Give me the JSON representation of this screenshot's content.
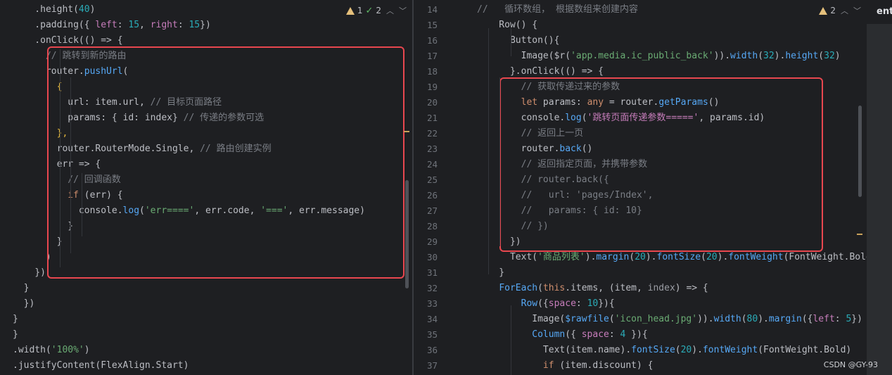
{
  "left_editor": {
    "inspection": {
      "warnings": "1",
      "weak_warnings": "2"
    },
    "lines": [
      [
        [
          "    .height(",
          "plain"
        ],
        [
          "40",
          "num"
        ],
        [
          ")",
          "plain"
        ]
      ],
      [
        [
          "    .padding({ ",
          "plain"
        ],
        [
          "left",
          "key"
        ],
        [
          ": ",
          "plain"
        ],
        [
          "15",
          "num"
        ],
        [
          ", ",
          "plain"
        ],
        [
          "right",
          "key"
        ],
        [
          ": ",
          "plain"
        ],
        [
          "15",
          "num"
        ],
        [
          "})",
          "plain"
        ]
      ],
      [
        [
          "    .onClick(() => {",
          "plain"
        ]
      ],
      [
        [
          "      // 跳转到新的路由",
          "comment"
        ]
      ],
      [
        [
          "      router.",
          "plain"
        ],
        [
          "pushUrl",
          "fn"
        ],
        [
          "(",
          "plain"
        ]
      ],
      [
        [
          "        {",
          "brace"
        ]
      ],
      [
        [
          "          url: item.url, ",
          "plain"
        ],
        [
          "// 目标页面路径",
          "comment"
        ]
      ],
      [
        [
          "          params: { id: index} ",
          "plain"
        ],
        [
          "// 传递的参数可选",
          "comment"
        ]
      ],
      [
        [
          "        },",
          "brace"
        ]
      ],
      [
        [
          "        router.RouterMode.Single, ",
          "plain"
        ],
        [
          "// 路由创建实例",
          "comment"
        ]
      ],
      [
        [
          "        err => {",
          "plain"
        ]
      ],
      [
        [
          "          // 回调函数",
          "comment"
        ]
      ],
      [
        [
          "          ",
          "plain"
        ],
        [
          "if",
          "kw"
        ],
        [
          " (err) {",
          "plain"
        ]
      ],
      [
        [
          "            console.",
          "plain"
        ],
        [
          "log",
          "fn"
        ],
        [
          "(",
          "plain"
        ],
        [
          "'err===='",
          "str"
        ],
        [
          ", err.code, ",
          "plain"
        ],
        [
          "'==='",
          "str"
        ],
        [
          ", err.message)",
          "plain"
        ]
      ],
      [
        [
          "          }",
          "plain"
        ]
      ],
      [
        [
          "        }",
          "plain"
        ]
      ],
      [
        [
          "      )",
          "plain"
        ]
      ],
      [
        [
          "    })",
          "plain"
        ]
      ],
      [
        [
          "  }",
          "plain"
        ]
      ],
      [
        [
          "  })",
          "plain"
        ]
      ],
      [
        [
          "}",
          "plain"
        ]
      ],
      [
        [
          "}",
          "plain"
        ]
      ],
      [
        [
          ".width(",
          "plain"
        ],
        [
          "'100%'",
          "str"
        ],
        [
          ")",
          "plain"
        ]
      ],
      [
        [
          ".justifyContent(FlexAlign.Start)",
          "plain"
        ]
      ]
    ]
  },
  "right_editor": {
    "inspection": {
      "warnings": "2"
    },
    "line_numbers": [
      "14",
      "15",
      "16",
      "17",
      "18",
      "19",
      "20",
      "21",
      "22",
      "23",
      "24",
      "25",
      "26",
      "27",
      "28",
      "29",
      "30",
      "31",
      "32",
      "33",
      "34",
      "35",
      "36",
      "37"
    ],
    "lines": [
      [
        [
          "//   循环数组， 根据数组来创建内容",
          "comment"
        ]
      ],
      [
        [
          "    Row() {",
          "plain"
        ]
      ],
      [
        [
          "      Button(){",
          "plain"
        ]
      ],
      [
        [
          "        Image($r(",
          "plain"
        ],
        [
          "'app.media.ic_public_back'",
          "str"
        ],
        [
          ")).",
          "plain"
        ],
        [
          "width",
          "fn"
        ],
        [
          "(",
          "plain"
        ],
        [
          "32",
          "num"
        ],
        [
          ").",
          "plain"
        ],
        [
          "height",
          "fn"
        ],
        [
          "(",
          "plain"
        ],
        [
          "32",
          "num"
        ],
        [
          ")",
          "plain"
        ]
      ],
      [
        [
          "      }.onClick(() => {",
          "plain"
        ]
      ],
      [
        [
          "        // 获取传递过来的参数",
          "comment"
        ]
      ],
      [
        [
          "        ",
          "plain"
        ],
        [
          "let",
          "kw"
        ],
        [
          " params: ",
          "plain"
        ],
        [
          "any",
          "kw"
        ],
        [
          " = router.",
          "plain"
        ],
        [
          "getParams",
          "fn"
        ],
        [
          "()",
          "plain"
        ]
      ],
      [
        [
          "        console.",
          "plain"
        ],
        [
          "log",
          "fn"
        ],
        [
          "(",
          "plain"
        ],
        [
          "'跳转页面传递参数====='",
          "str2"
        ],
        [
          ", params.id)",
          "plain"
        ]
      ],
      [
        [
          "        // 返回上一页",
          "comment"
        ]
      ],
      [
        [
          "        router.",
          "plain"
        ],
        [
          "back",
          "fn"
        ],
        [
          "()",
          "plain"
        ]
      ],
      [
        [
          "        // 返回指定页面，并携带参数",
          "comment"
        ]
      ],
      [
        [
          "        // router.back({",
          "comment"
        ]
      ],
      [
        [
          "        //   url: 'pages/Index',",
          "comment"
        ]
      ],
      [
        [
          "        //   params: { id: 10}",
          "comment"
        ]
      ],
      [
        [
          "        // })",
          "comment"
        ]
      ],
      [
        [
          "      })",
          "plain"
        ]
      ],
      [
        [
          "      Text(",
          "plain"
        ],
        [
          "'商品列表'",
          "str"
        ],
        [
          ").",
          "plain"
        ],
        [
          "margin",
          "fn"
        ],
        [
          "(",
          "plain"
        ],
        [
          "20",
          "num"
        ],
        [
          ").",
          "plain"
        ],
        [
          "fontSize",
          "fn"
        ],
        [
          "(",
          "plain"
        ],
        [
          "20",
          "num"
        ],
        [
          ").",
          "plain"
        ],
        [
          "fontWeight",
          "fn"
        ],
        [
          "(FontWeight.Bold",
          "plain"
        ]
      ],
      [
        [
          "    }",
          "plain"
        ]
      ],
      [
        [
          "    ",
          "plain"
        ],
        [
          "ForEach",
          "fn"
        ],
        [
          "(",
          "plain"
        ],
        [
          "this",
          "kw"
        ],
        [
          ".items, (item, ",
          "plain"
        ],
        [
          "index",
          "param"
        ],
        [
          ") => {",
          "plain"
        ]
      ],
      [
        [
          "        ",
          "plain"
        ],
        [
          "Row",
          "fn"
        ],
        [
          "({",
          "plain"
        ],
        [
          "space",
          "key"
        ],
        [
          ": ",
          "plain"
        ],
        [
          "10",
          "num"
        ],
        [
          "}){",
          "plain"
        ]
      ],
      [
        [
          "          Image(",
          "plain"
        ],
        [
          "$rawfile",
          "fn"
        ],
        [
          "(",
          "plain"
        ],
        [
          "'icon_head.jpg'",
          "str"
        ],
        [
          ")).",
          "plain"
        ],
        [
          "width",
          "fn"
        ],
        [
          "(",
          "plain"
        ],
        [
          "80",
          "num"
        ],
        [
          ").",
          "plain"
        ],
        [
          "margin",
          "fn"
        ],
        [
          "({",
          "plain"
        ],
        [
          "left",
          "key"
        ],
        [
          ": ",
          "plain"
        ],
        [
          "5",
          "num"
        ],
        [
          "})",
          "plain"
        ]
      ],
      [
        [
          "          ",
          "plain"
        ],
        [
          "Column",
          "fn"
        ],
        [
          "({ ",
          "plain"
        ],
        [
          "space",
          "key"
        ],
        [
          ": ",
          "plain"
        ],
        [
          "4",
          "num"
        ],
        [
          " }){",
          "plain"
        ]
      ],
      [
        [
          "            Text(item.name).",
          "plain"
        ],
        [
          "fontSize",
          "fn"
        ],
        [
          "(",
          "plain"
        ],
        [
          "20",
          "num"
        ],
        [
          ").",
          "plain"
        ],
        [
          "fontWeight",
          "fn"
        ],
        [
          "(FontWeight.Bold)",
          "plain"
        ]
      ],
      [
        [
          "            ",
          "plain"
        ],
        [
          "if",
          "kw"
        ],
        [
          " (item.discount) {",
          "plain"
        ]
      ]
    ]
  },
  "tab": {
    "label": "ent"
  },
  "watermark": "CSDN @GY-93",
  "colors": {
    "plain": "#bcbec4",
    "num": "#2aacb8",
    "str": "#6aab73",
    "str2": "#c77dbb",
    "comment": "#7a7e85",
    "kw": "#cf8e6d",
    "fn": "#56a8f5",
    "key": "#c77dbb",
    "brace": "#e0b43c",
    "param": "#9a9ca3",
    "highlight_border": "#e8474f"
  }
}
